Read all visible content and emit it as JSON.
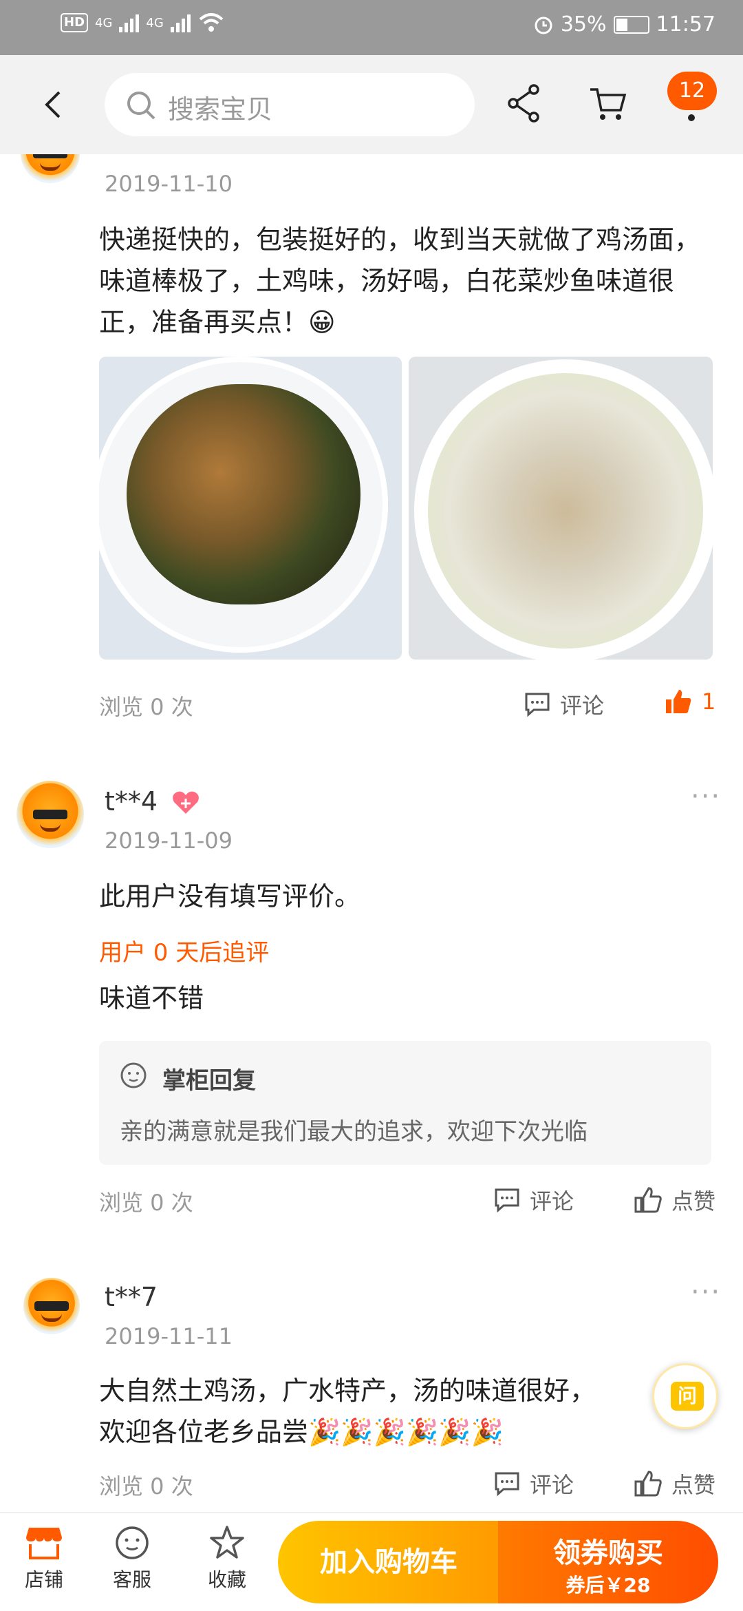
{
  "status_bar": {
    "hd": "HD",
    "sim1": "4G",
    "sim2": "4G",
    "battery_pct": "35%",
    "time": "11:57"
  },
  "nav": {
    "search_placeholder": "搜索宝贝",
    "badge_count": "12"
  },
  "reviews": [
    {
      "date": "2019-11-10",
      "text": "快递挺快的，包装挺好的，收到当天就做了鸡汤面，味道棒极了，土鸡味，汤好喝，白花菜炒鱼味道很正，准备再买点！😀",
      "views": "浏览 0 次",
      "comment": "评论",
      "likes": "1"
    },
    {
      "user": "t**4",
      "date": "2019-11-09",
      "text": "此用户没有填写评价。",
      "followup_label": "用户 0 天后追评",
      "followup_text": "味道不错",
      "reply_title": "掌柜回复",
      "reply_text": "亲的满意就是我们最大的追求，欢迎下次光临",
      "views": "浏览 0 次",
      "comment": "评论",
      "like": "点赞"
    },
    {
      "user": "t**7",
      "date": "2019-11-11",
      "text_line1": "大自然土鸡汤，广水特产，汤的味道很好，",
      "text_line2": "欢迎各位老乡品尝🎉🎉🎉🎉🎉🎉",
      "views": "浏览 0 次",
      "comment": "评论",
      "like": "点赞"
    }
  ],
  "float": {
    "ask": "问"
  },
  "bottom_bar": {
    "store": "店铺",
    "service": "客服",
    "favorite": "收藏",
    "add_cart": "加入购物车",
    "buy_line1": "领券购买",
    "buy_line2": "券后￥28"
  },
  "colors": {
    "accent": "#ff5a00",
    "cart_button": "#ffb400",
    "status_bar": "#9a9a9a"
  }
}
